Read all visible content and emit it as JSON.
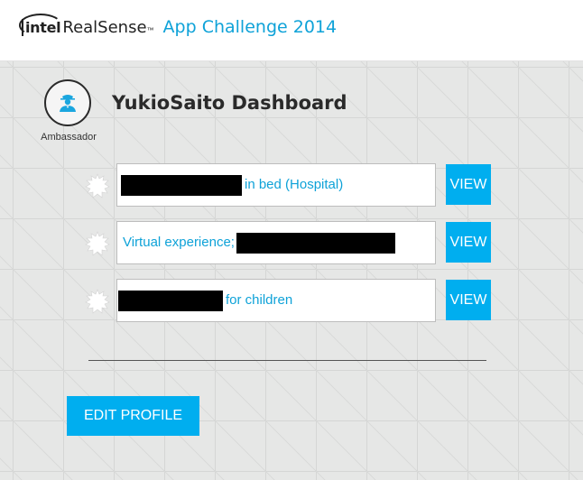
{
  "header": {
    "logo_intel": "intel",
    "logo_realsense": "RealSense",
    "logo_tm": "™",
    "app_title": "App Challenge 2014"
  },
  "profile": {
    "avatar_icon": "spy-user-icon",
    "role": "Ambassador",
    "title": "YukioSaito Dashboard"
  },
  "entries": [
    {
      "text_before": "",
      "redaction": "redacted",
      "text_after": "in bed (Hospital)",
      "button": "VIEW",
      "icon": "gear-icon"
    },
    {
      "text_before": "Virtual experience;",
      "redaction": "redacted",
      "text_after": "",
      "button": "VIEW",
      "icon": "gear-icon"
    },
    {
      "text_before": "",
      "redaction": "redacted",
      "text_after": "for children",
      "button": "VIEW",
      "icon": "gear-icon"
    }
  ],
  "actions": {
    "edit_profile": "EDIT PROFILE"
  },
  "colors": {
    "accent": "#00aeef",
    "link_text": "#0ea2d8",
    "background": "#e6e7e6"
  }
}
